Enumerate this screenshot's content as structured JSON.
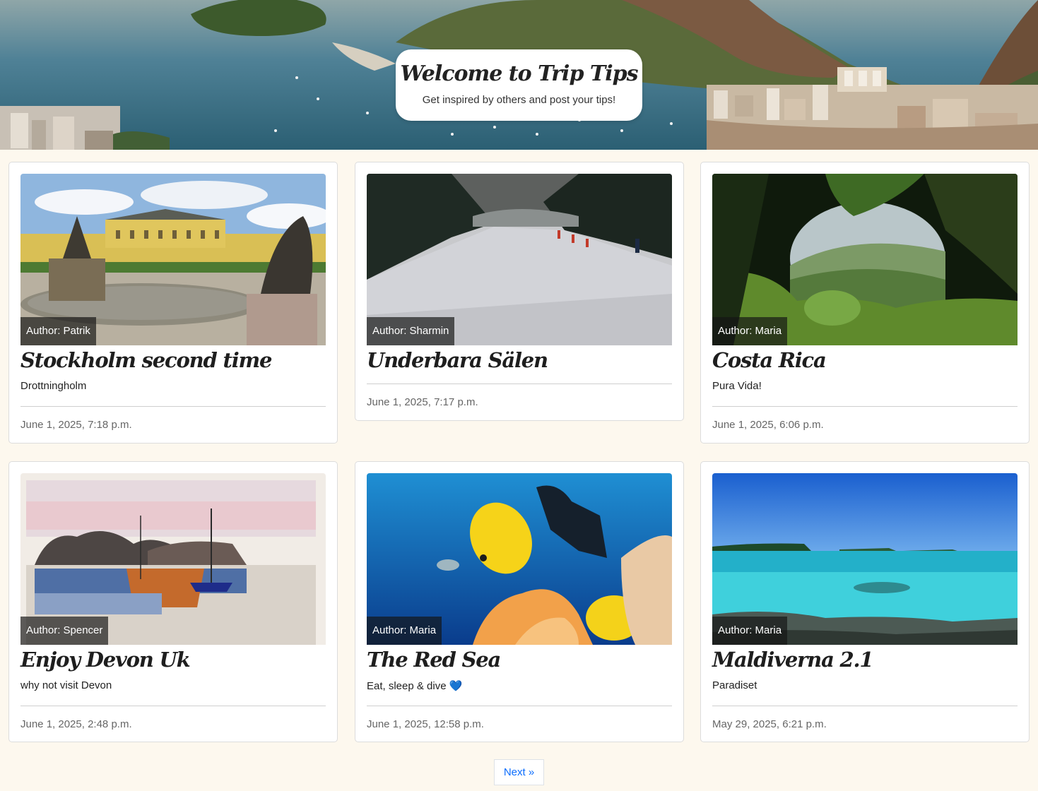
{
  "hero": {
    "title": "Welcome to Trip Tips",
    "subtitle": "Get inspired by others and post your tips!"
  },
  "posts": [
    {
      "title": "Stockholm second time",
      "author": "Author: Patrik",
      "excerpt": "Drottningholm",
      "date": "June 1, 2025, 7:18 p.m.",
      "image": "palace-photo"
    },
    {
      "title": "Underbara Sälen",
      "author": "Author: Sharmin",
      "excerpt": "",
      "date": "June 1, 2025, 7:17 p.m.",
      "image": "ski-slope-photo"
    },
    {
      "title": "Costa Rica",
      "author": "Author: Maria",
      "excerpt": "Pura Vida!",
      "date": "June 1, 2025, 6:06 p.m.",
      "image": "jungle-photo"
    },
    {
      "title": "Enjoy Devon Uk",
      "author": "Author: Spencer",
      "excerpt": "why not visit Devon",
      "date": "June 1, 2025, 2:48 p.m.",
      "image": "watercolor-painting"
    },
    {
      "title": "The Red Sea",
      "author": "Author: Maria",
      "excerpt": "Eat, sleep & dive 💙",
      "date": "June 1, 2025, 12:58 p.m.",
      "image": "diving-photo"
    },
    {
      "title": "Maldiverna 2.1",
      "author": "Author: Maria",
      "excerpt": "Paradiset",
      "date": "May 29, 2025, 6:21 p.m.",
      "image": "beach-photo"
    }
  ],
  "pagination": {
    "next_label": "Next »"
  },
  "colors": {
    "page_background": "#fdf8ee",
    "link": "#0d6efd",
    "author_overlay": "#141414"
  }
}
